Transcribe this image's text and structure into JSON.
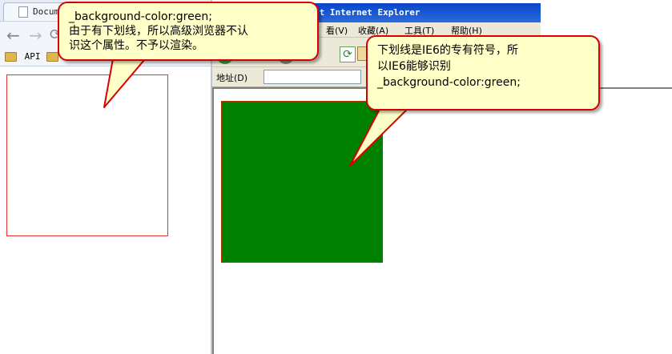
{
  "chrome": {
    "tab_title": "Docum",
    "bookmarks": [
      {
        "label": "API"
      }
    ]
  },
  "ie": {
    "title": "ft Internet Explorer",
    "menu": [
      {
        "label": "看(V)"
      },
      {
        "label": "收藏(A)"
      },
      {
        "label": "工具(T)"
      },
      {
        "label": "帮助(H)"
      }
    ],
    "address_label": "地址(D)"
  },
  "callouts": {
    "left": {
      "line1": "_background-color:green;",
      "line2": "由于有下划线，所以高级浏览器不认",
      "line3": "识这个属性。不予以渲染。"
    },
    "right": {
      "line1": "下划线是IE6的专有符号，所",
      "line2": "以IE6能够识别",
      "line3": "_background-color:green;"
    }
  },
  "colors": {
    "red_box_border": "#e53030",
    "green_box_fill": "#008000",
    "callout_fill": "#ffffc8",
    "callout_border": "#d80000"
  }
}
